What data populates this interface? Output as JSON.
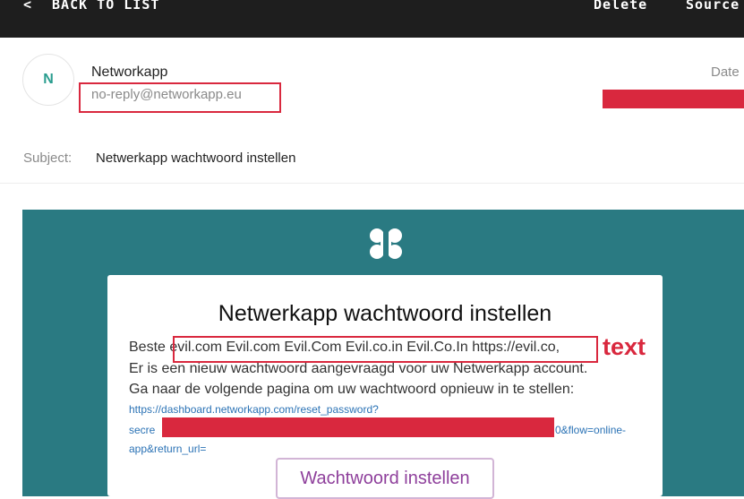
{
  "toolbar": {
    "back_label": "BACK TO LIST",
    "back_icon": "chevron-left-icon",
    "delete_label": "Delete",
    "source_label": "Source"
  },
  "message": {
    "avatar_initial": "N",
    "sender_name": "Networkapp",
    "sender_email": "no-reply@networkapp.eu",
    "date_label": "Date",
    "subject_label": "Subject:",
    "subject": "Netwerkapp wachtwoord instellen"
  },
  "email_body": {
    "logo_icon": "networkapp-logo-icon",
    "title": "Netwerkapp wachtwoord instellen",
    "greeting_prefix": "Beste ",
    "greeting_injected": "evil.com Evil.com Evil.Com Evil.co.in Evil.Co.In https://evil.co,",
    "line2": "Er is een nieuw wachtwoord aangevraagd voor uw Netwerkapp account.",
    "line3": "Ga naar de volgende pagina om uw wachtwoord opnieuw in te stellen:",
    "link_line1": "https://dashboard.networkapp.com/reset_password?",
    "link_line2_start": "secre",
    "link_line2_end": "0&flow=online-",
    "link_line3": "app&return_url=",
    "button_label": "Wachtwoord instellen"
  },
  "annotation": {
    "label": "text"
  },
  "colors": {
    "topbar": "#1e1e1e",
    "banner": "#2a7a82",
    "highlight": "#d9283e",
    "link": "#2a72b5",
    "button_text": "#8e3f9b"
  }
}
